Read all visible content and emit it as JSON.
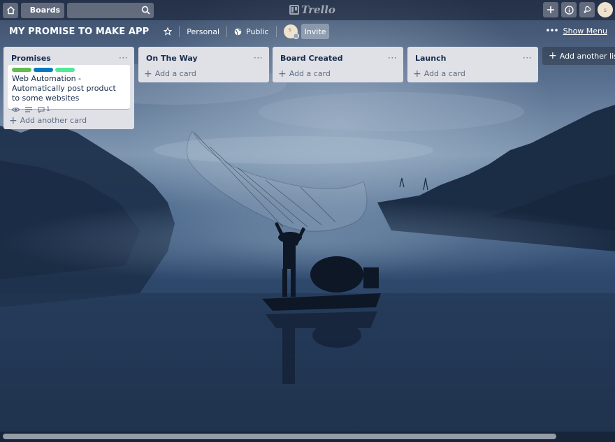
{
  "topbar": {
    "boards_label": "Boards",
    "search": {
      "value": "",
      "placeholder": ""
    },
    "logo_text": "Trello",
    "avatar_initial": "s"
  },
  "board": {
    "title": "MY PROMISE TO MAKE APP",
    "team_label": "Personal",
    "visibility_label": "Public",
    "member_initial": "s",
    "invite_label": "Invite",
    "show_menu_label": "Show Menu"
  },
  "lists": [
    {
      "title": "Promises",
      "cards": [
        {
          "labels": [
            "#61bd4f",
            "#0079bf",
            "#51e898"
          ],
          "title": "Web Automation - Automatically post product to some websites",
          "badges": {
            "watching": true,
            "description": true,
            "comments": "1"
          }
        }
      ],
      "add_label": "Add another card"
    },
    {
      "title": "On The Way",
      "cards": [],
      "add_label": "Add a card"
    },
    {
      "title": "Board Created",
      "cards": [],
      "add_label": "Add a card"
    },
    {
      "title": "Launch",
      "cards": [],
      "add_label": "Add a card"
    }
  ],
  "add_list_label": "Add another list",
  "icons": {
    "home": "home-icon",
    "boards": "board-icon",
    "search": "search-icon",
    "create": "plus-icon",
    "info": "info-icon",
    "notifications": "bell-icon",
    "star": "star-icon",
    "visibility": "globe-icon",
    "menu": "more-horizontal-icon",
    "watch": "eye-icon",
    "description": "description-icon",
    "comment": "comment-icon"
  },
  "colors": {
    "list_bg": "#dfe1e6",
    "card_bg": "#ffffff",
    "label_green": "#61bd4f",
    "label_blue": "#0079bf",
    "label_lime": "#51e898",
    "background_tint": "#2c4160"
  }
}
